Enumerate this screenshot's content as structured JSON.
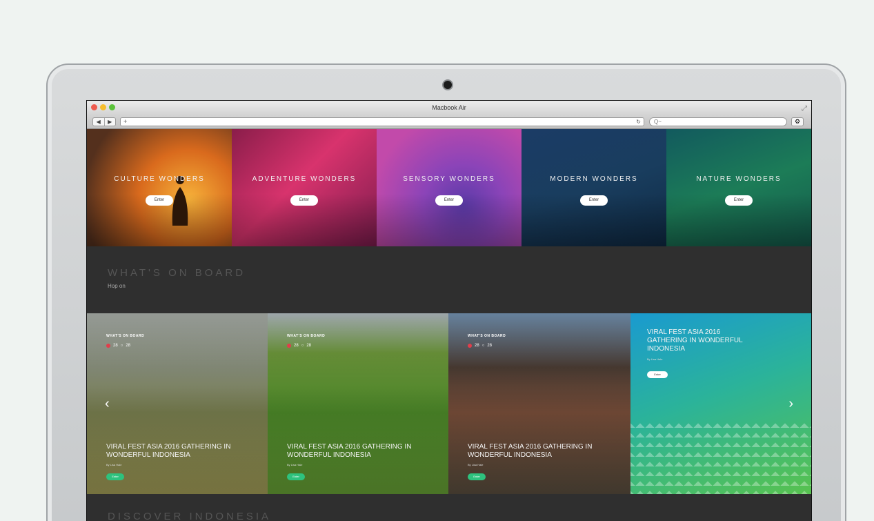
{
  "browser": {
    "window_title": "Macbook Air",
    "address": "+",
    "search_placeholder": "Q~",
    "nav_back": "◀",
    "nav_forward": "▶",
    "gear": "⚙"
  },
  "wonders": [
    {
      "title": "CULTURE WONDERS",
      "button": "Enter"
    },
    {
      "title": "ADVENTURE WONDERS",
      "button": "Enter"
    },
    {
      "title": "SENSORY WONDERS",
      "button": "Enter"
    },
    {
      "title": "MODERN WONDERS",
      "button": "Enter"
    },
    {
      "title": "NATURE WONDERS",
      "button": "Enter"
    }
  ],
  "board": {
    "title": "WHAT'S ON BOARD",
    "subtitle": "Hop on"
  },
  "cards": [
    {
      "tag": "WHAT'S ON BOARD",
      "likes": "28",
      "comments": "28",
      "title": "VIRAL FEST ASIA 2016 GATHERING IN WONDERFUL INDONESIA",
      "author": "By Lisa Hale",
      "button": "Enter"
    },
    {
      "tag": "WHAT'S ON BOARD",
      "likes": "28",
      "comments": "28",
      "title": "VIRAL FEST ASIA 2016 GATHERING IN WONDERFUL INDONESIA",
      "author": "By Lisa Hale",
      "button": "Enter"
    },
    {
      "tag": "WHAT'S ON BOARD",
      "likes": "28",
      "comments": "28",
      "title": "VIRAL FEST ASIA 2016 GATHERING IN WONDERFUL INDONESIA",
      "author": "By Lisa Hale",
      "button": "Enter"
    },
    {
      "tag": "",
      "likes": "",
      "comments": "",
      "title": "VIRAL FEST ASIA 2016 GATHERING IN WONDERFUL INDONESIA",
      "author": "By Lisa Hale",
      "button": "Enter"
    }
  ],
  "carousel": {
    "prev": "‹",
    "next": "›"
  },
  "discover": {
    "title": "DISCOVER INDONESIA"
  }
}
